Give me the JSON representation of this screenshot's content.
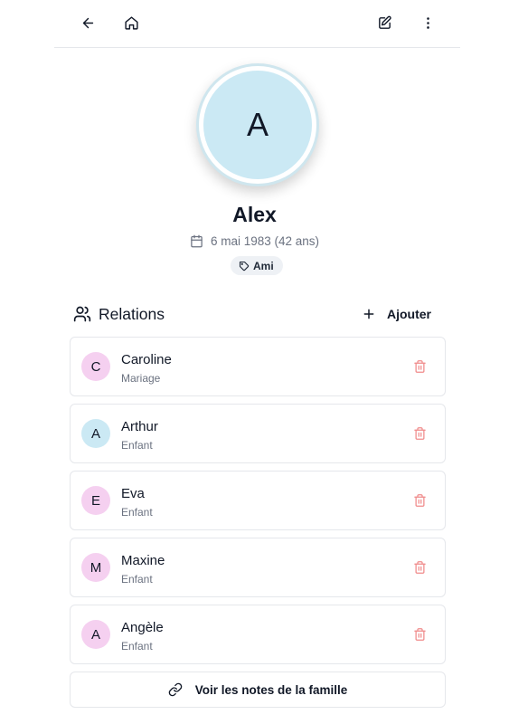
{
  "toolbar": {
    "back_icon": "arrow-left-icon",
    "home_icon": "home-icon",
    "edit_icon": "edit-icon",
    "more_icon": "more-vertical-icon"
  },
  "profile": {
    "initial": "A",
    "name": "Alex",
    "birth": "6 mai 1983 (42 ans)",
    "tag": "Ami",
    "avatar_color": "#cbe9f4"
  },
  "relations": {
    "title": "Relations",
    "add_label": "Ajouter",
    "items": [
      {
        "initial": "C",
        "name": "Caroline",
        "relation": "Mariage",
        "color": "#f5d0f0"
      },
      {
        "initial": "A",
        "name": "Arthur",
        "relation": "Enfant",
        "color": "#cbe9f4"
      },
      {
        "initial": "E",
        "name": "Eva",
        "relation": "Enfant",
        "color": "#f5d0f0"
      },
      {
        "initial": "M",
        "name": "Maxine",
        "relation": "Enfant",
        "color": "#f5d0f0"
      },
      {
        "initial": "A",
        "name": "Angèle",
        "relation": "Enfant",
        "color": "#f5d0f0"
      }
    ]
  },
  "footer": {
    "notes_label": "Voir les notes de la famille"
  },
  "colors": {
    "delete": "#f08a8a",
    "border": "#e5e7eb",
    "muted": "#6b7280"
  }
}
